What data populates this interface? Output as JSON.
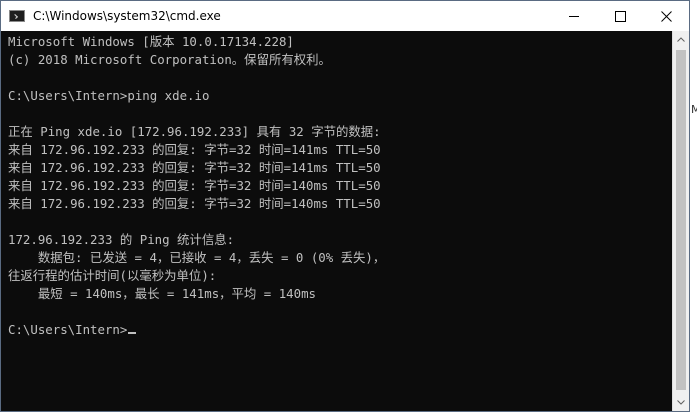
{
  "window": {
    "title": "C:\\Windows\\system32\\cmd.exe",
    "app_icon": "console-icon",
    "controls": {
      "minimize_icon": "minimize-icon",
      "maximize_icon": "maximize-icon",
      "close_icon": "close-icon"
    }
  },
  "console": {
    "lines": [
      "Microsoft Windows [版本 10.0.17134.228]",
      "(c) 2018 Microsoft Corporation。保留所有权利。",
      "",
      "C:\\Users\\Intern>ping xde.io",
      "",
      "正在 Ping xde.io [172.96.192.233] 具有 32 字节的数据:",
      "来自 172.96.192.233 的回复: 字节=32 时间=141ms TTL=50",
      "来自 172.96.192.233 的回复: 字节=32 时间=141ms TTL=50",
      "来自 172.96.192.233 的回复: 字节=32 时间=140ms TTL=50",
      "来自 172.96.192.233 的回复: 字节=32 时间=140ms TTL=50",
      "",
      "172.96.192.233 的 Ping 统计信息:",
      "    数据包: 已发送 = 4，已接收 = 4，丢失 = 0 (0% 丢失)，",
      "往返行程的估计时间(以毫秒为单位):",
      "    最短 = 140ms，最长 = 141ms，平均 = 140ms",
      "",
      "C:\\Users\\Intern>"
    ]
  },
  "colors": {
    "console_bg": "#0c0c0c",
    "console_text": "#c0c0c0",
    "titlebar_bg": "#ffffff"
  },
  "edge_text": "M"
}
